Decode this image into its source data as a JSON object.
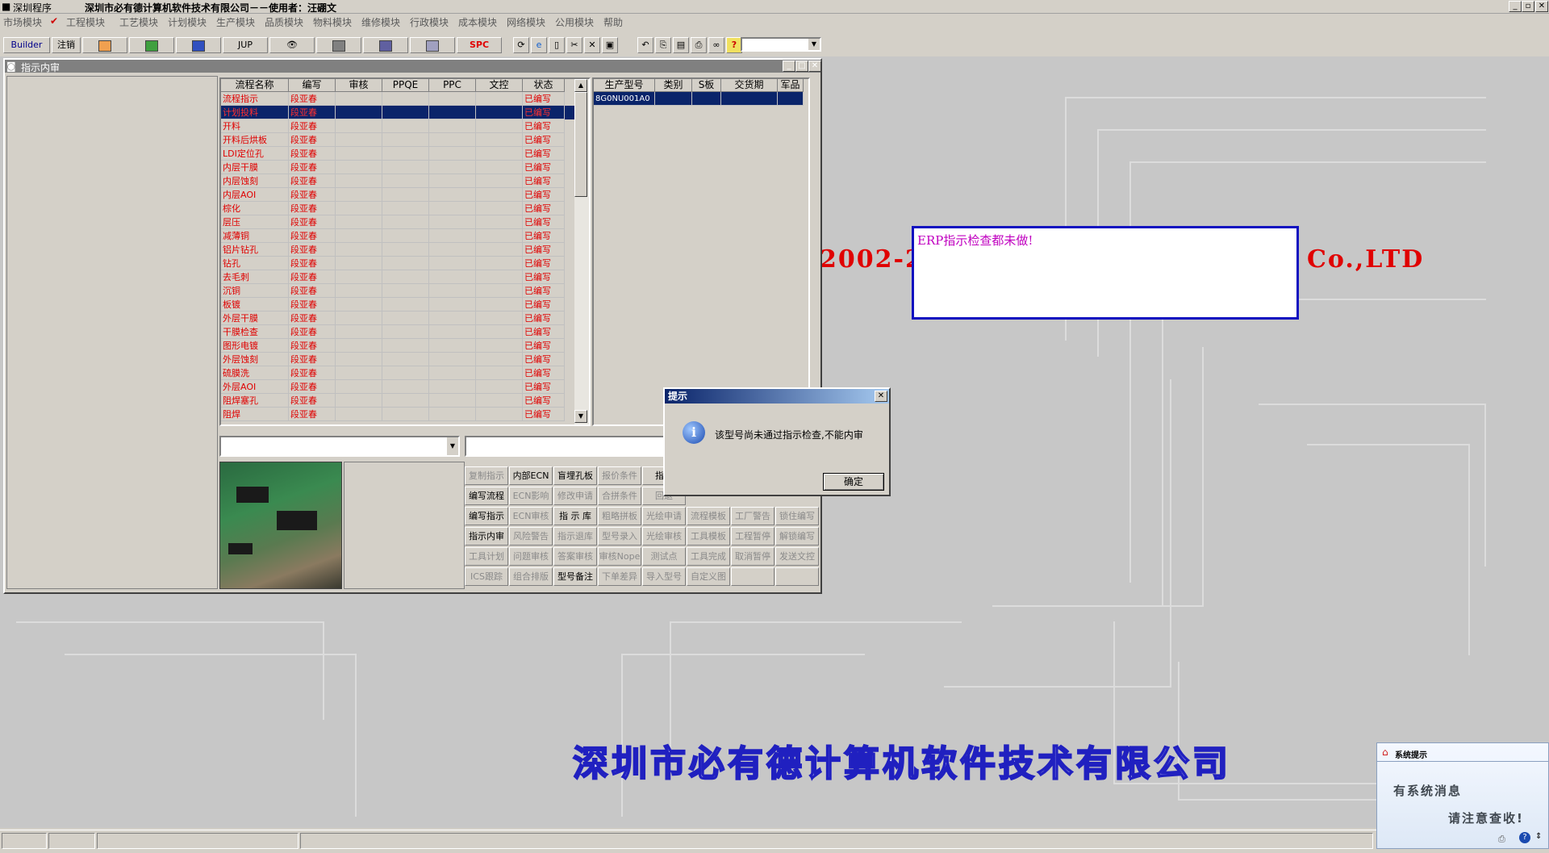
{
  "app": {
    "title_left": "深圳程序",
    "title_main": "深圳市必有德计算机软件技术有限公司－－使用者：汪硼文"
  },
  "menu": [
    "市场模块",
    "工程模块",
    "工艺模块",
    "计划模块",
    "生产模块",
    "品质模块",
    "物料模块",
    "维修模块",
    "行政模块",
    "成本模块",
    "网络模块",
    "公用模块",
    "帮助"
  ],
  "toolbar": {
    "builder": "Builder",
    "logout": "注销",
    "jup": "JUP",
    "spc": "SPC"
  },
  "desktop": {
    "year_text": "2002-2",
    "ltd_text": "Co.,LTD",
    "company": "深圳市必有德计算机软件技术有限公司"
  },
  "child_window": {
    "title": "指示内审",
    "columns": [
      "流程名称",
      "编写",
      "审核",
      "PPQE",
      "PPC",
      "文控",
      "状态"
    ],
    "rows": [
      {
        "name": "流程指示",
        "writer": "段亚春",
        "status": "已编写"
      },
      {
        "name": "计划投料",
        "writer": "段亚春",
        "status": "已编写",
        "selected": true
      },
      {
        "name": "开料",
        "writer": "段亚春",
        "status": "已编写"
      },
      {
        "name": "开料后烘板",
        "writer": "段亚春",
        "status": "已编写"
      },
      {
        "name": "LDI定位孔",
        "writer": "段亚春",
        "status": "已编写"
      },
      {
        "name": "内层干膜",
        "writer": "段亚春",
        "status": "已编写"
      },
      {
        "name": "内层蚀刻",
        "writer": "段亚春",
        "status": "已编写"
      },
      {
        "name": "内层AOI",
        "writer": "段亚春",
        "status": "已编写"
      },
      {
        "name": "棕化",
        "writer": "段亚春",
        "status": "已编写"
      },
      {
        "name": "层压",
        "writer": "段亚春",
        "status": "已编写"
      },
      {
        "name": "减薄铜",
        "writer": "段亚春",
        "status": "已编写"
      },
      {
        "name": "铝片钻孔",
        "writer": "段亚春",
        "status": "已编写"
      },
      {
        "name": "钻孔",
        "writer": "段亚春",
        "status": "已编写"
      },
      {
        "name": "去毛刺",
        "writer": "段亚春",
        "status": "已编写"
      },
      {
        "name": "沉铜",
        "writer": "段亚春",
        "status": "已编写"
      },
      {
        "name": "板镀",
        "writer": "段亚春",
        "status": "已编写"
      },
      {
        "name": "外层干膜",
        "writer": "段亚春",
        "status": "已编写"
      },
      {
        "name": "干膜检查",
        "writer": "段亚春",
        "status": "已编写"
      },
      {
        "name": "图形电镀",
        "writer": "段亚春",
        "status": "已编写"
      },
      {
        "name": "外层蚀刻",
        "writer": "段亚春",
        "status": "已编写"
      },
      {
        "name": "硫膜洗",
        "writer": "段亚春",
        "status": "已编写"
      },
      {
        "name": "外层AOI",
        "writer": "段亚春",
        "status": "已编写"
      },
      {
        "name": "阻焊塞孔",
        "writer": "段亚春",
        "status": "已编写"
      },
      {
        "name": "阻焊",
        "writer": "段亚春",
        "status": "已编写"
      }
    ],
    "right_columns": [
      "生产型号",
      "类别",
      "S板",
      "交货期",
      "军品"
    ],
    "right_rows": [
      {
        "model": "8G0NU001A0"
      }
    ],
    "buttons": [
      [
        {
          "t": "复制指示",
          "d": true
        },
        {
          "t": "内部ECN",
          "d": false
        },
        {
          "t": "盲埋孔板",
          "d": false
        },
        {
          "t": "报价条件",
          "d": true
        },
        {
          "t": "指示",
          "d": false
        }
      ],
      [
        {
          "t": "编写流程",
          "d": false
        },
        {
          "t": "ECN影响",
          "d": true
        },
        {
          "t": "修改申请",
          "d": true
        },
        {
          "t": "合拼条件",
          "d": true
        },
        {
          "t": "回退",
          "d": true
        }
      ],
      [
        {
          "t": "编写指示",
          "d": false
        },
        {
          "t": "ECN审核",
          "d": true
        },
        {
          "t": "指 示 库",
          "d": false
        },
        {
          "t": "粗略拼板",
          "d": true
        },
        {
          "t": "光绘申请",
          "d": true
        },
        {
          "t": "流程模板",
          "d": true
        },
        {
          "t": "工厂警告",
          "d": true
        },
        {
          "t": "锁住编写",
          "d": true
        }
      ],
      [
        {
          "t": "指示内审",
          "d": false
        },
        {
          "t": "风险警告",
          "d": true
        },
        {
          "t": "指示退库",
          "d": true
        },
        {
          "t": "型号录入",
          "d": true
        },
        {
          "t": "光绘审核",
          "d": true
        },
        {
          "t": "工具模板",
          "d": true
        },
        {
          "t": "工程暂停",
          "d": true
        },
        {
          "t": "解锁编写",
          "d": true
        }
      ],
      [
        {
          "t": "工具计划",
          "d": true
        },
        {
          "t": "问题审核",
          "d": true
        },
        {
          "t": "答案审核",
          "d": true
        },
        {
          "t": "审核Nope",
          "d": true
        },
        {
          "t": "测试点",
          "d": true
        },
        {
          "t": "工具完成",
          "d": true
        },
        {
          "t": "取消暂停",
          "d": true
        },
        {
          "t": "发送文控",
          "d": true
        }
      ],
      [
        {
          "t": "ICS跟踪",
          "d": true
        },
        {
          "t": "组合排版",
          "d": true
        },
        {
          "t": "型号备注",
          "d": false
        },
        {
          "t": "下单差异",
          "d": true
        },
        {
          "t": "导入型号",
          "d": true
        },
        {
          "t": "自定义图",
          "d": true
        },
        {
          "t": "",
          "d": true
        },
        {
          "t": "",
          "d": true
        }
      ]
    ]
  },
  "erp_message": "ERP指示检查都未做!",
  "dialog": {
    "title": "提示",
    "message": "该型号尚未通过指示检查,不能内审",
    "ok": "确定"
  },
  "system_popup": {
    "title": "系统提示",
    "line1": "有系统消息",
    "line2": "请注意查收!"
  }
}
